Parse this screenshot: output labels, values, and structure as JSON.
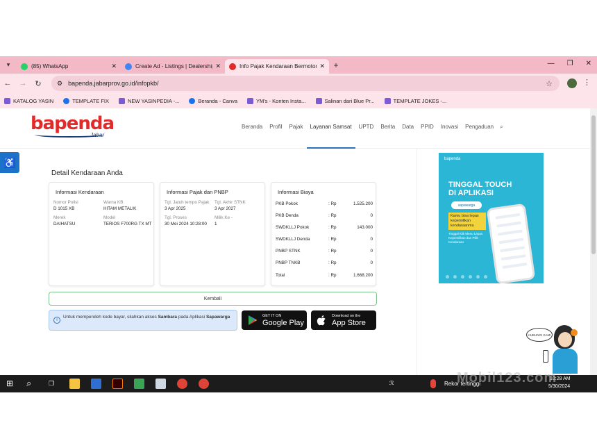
{
  "browser": {
    "tabs": [
      {
        "title": "(85) WhatsApp",
        "favicon_color": "#25d366",
        "active": false
      },
      {
        "title": "Create Ad - Listings | Dealership",
        "favicon_color": "#4285f4",
        "active": false
      },
      {
        "title": "Info Pajak Kendaraan Bermotor",
        "favicon_color": "#e12b2b",
        "active": true
      }
    ],
    "new_tab": "+",
    "url": "bapenda.jabarprov.go.id/infopkb/",
    "bookmarks": [
      {
        "label": "KATALOG YASIN",
        "icon_color": "#7b5cd6"
      },
      {
        "label": "TEMPLATE FIX",
        "icon_color": "#1a73e8"
      },
      {
        "label": "NEW YASINPEDIA -...",
        "icon_color": "#7b5cd6"
      },
      {
        "label": "Beranda - Canva",
        "icon_color": "#1a73e8"
      },
      {
        "label": "YM's - Konten Insta...",
        "icon_color": "#7b5cd6"
      },
      {
        "label": "Salinan dari Blue Pr...",
        "icon_color": "#7b5cd6"
      },
      {
        "label": "TEMPLATE JOKES -...",
        "icon_color": "#7b5cd6"
      }
    ]
  },
  "site": {
    "logo": "bapenda",
    "logo_sub": "Jabar",
    "nav": [
      "Beranda",
      "Profil",
      "Pajak",
      "Layanan Samsat",
      "UPTD",
      "Berita",
      "Data",
      "PPID",
      "Inovasi",
      "Pengaduan"
    ],
    "nav_active": "Layanan Samsat"
  },
  "main": {
    "title": "Detail Kendaraan Anda",
    "vehicle": {
      "title": "Informasi Kendaraan",
      "nopol_label": "Nomor Polisi",
      "nopol": "D 1015 XB",
      "warna_label": "Warna KB",
      "warna": "HITAM METALIK",
      "merek_label": "Merek",
      "merek": "DAIHATSU",
      "model_label": "Model",
      "model": "TERIOS F700RG TX MT"
    },
    "tax": {
      "title": "Informasi Pajak dan PNBP",
      "jt_pajak_label": "Tgl. Jatuh tempo Pajak",
      "jt_pajak": "3 Apr 2025",
      "akhir_stnk_label": "Tgl. Akhir STNK",
      "akhir_stnk": "3 Apr 2027",
      "proses_label": "Tgl. Proses",
      "proses": "30 Mei 2024 10:28:00",
      "milik_label": "Milik Ke -",
      "milik": "1"
    },
    "cost": {
      "title": "Informasi Biaya",
      "rows": [
        {
          "label": "PKB Pokok",
          "cur": ": Rp",
          "value": "1.525.200"
        },
        {
          "label": "PKB Denda",
          "cur": ": Rp",
          "value": "0"
        },
        {
          "label": "SWDKLLJ Pokok",
          "cur": ": Rp",
          "value": "143.000"
        },
        {
          "label": "SWDKLLJ Denda",
          "cur": ": Rp",
          "value": "0"
        },
        {
          "label": "PNBP STNK",
          "cur": ": Rp",
          "value": "0"
        },
        {
          "label": "PNBP TNKB",
          "cur": ": Rp",
          "value": "0"
        },
        {
          "label": "Total",
          "cur": ": Rp",
          "value": "1.668.200"
        }
      ]
    },
    "back": "Kembali",
    "info": {
      "pre": "Untuk memperoleh kode bayar, silahkan akses ",
      "b1": "Sambara",
      "mid": " pada Aplikasi ",
      "b2": "Sapawarga"
    },
    "google_play": {
      "small": "GET IT ON",
      "big": "Google Play"
    },
    "app_store": {
      "small": "Download on the",
      "big": "App Store"
    }
  },
  "banner": {
    "brand": "bapenda",
    "headline1": "TINGGAL TOUCH",
    "headline2": "DI APLIKASI",
    "app": "sapawarga",
    "tag": "Kamu bisa lepas kepemilikan kendaraanmu",
    "small": "Tinggal Klik Menu Lepas Kepemilikan dan Pilih Kendaraan"
  },
  "mascot": {
    "bubble": "HUBUNGI KAMI"
  },
  "taskbar": {
    "weather": "Rekor tertinggi",
    "time": "10:28 AM",
    "date": "5/30/2024"
  },
  "watermark": "Mobil123.com"
}
